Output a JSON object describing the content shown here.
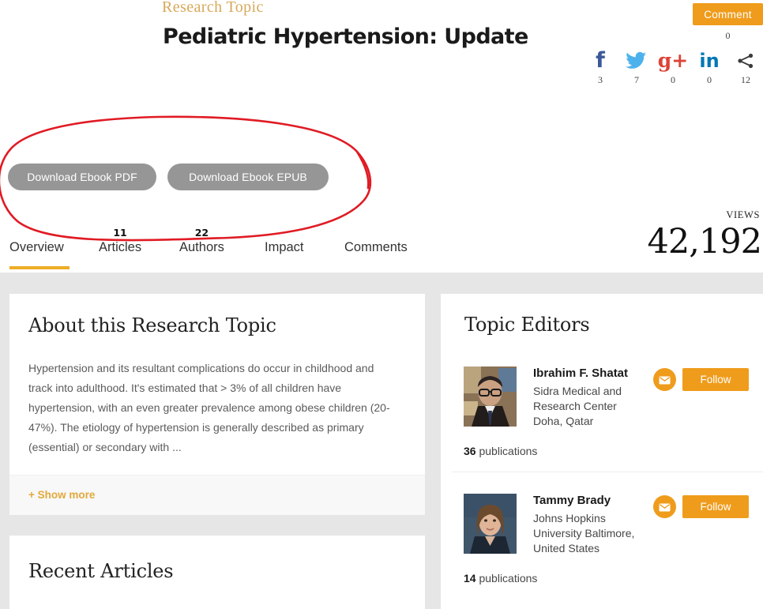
{
  "header": {
    "kicker": "Research Topic",
    "title": "Pediatric Hypertension: Update",
    "comment_label": "Comment",
    "comment_count": "0"
  },
  "social": [
    {
      "name": "facebook",
      "glyph": "f",
      "count": "3"
    },
    {
      "name": "twitter",
      "glyph": "",
      "count": "7"
    },
    {
      "name": "googleplus",
      "glyph": "g+",
      "count": "0"
    },
    {
      "name": "linkedin",
      "glyph": "in",
      "count": "0"
    },
    {
      "name": "share",
      "glyph": "",
      "count": "12"
    }
  ],
  "downloads": {
    "pdf_label": "Download Ebook PDF",
    "epub_label": "Download Ebook EPUB"
  },
  "tabs": [
    {
      "label": "Overview",
      "badge": "",
      "active": true
    },
    {
      "label": "Articles",
      "badge": "11",
      "active": false
    },
    {
      "label": "Authors",
      "badge": "22",
      "active": false
    },
    {
      "label": "Impact",
      "badge": "",
      "active": false
    },
    {
      "label": "Comments",
      "badge": "",
      "active": false
    }
  ],
  "views": {
    "label": "VIEWS",
    "value": "42,192"
  },
  "about": {
    "heading": "About this Research Topic",
    "body": "Hypertension and its resultant complications do occur in childhood and track into adulthood. It's estimated that > 3% of all children have hypertension, with an even greater prevalence among obese children (20-47%). The etiology of hypertension is generally described as primary (essential) or secondary with ...",
    "show_more": "+ Show more"
  },
  "recent_articles": {
    "heading": "Recent Articles"
  },
  "topic_editors": {
    "heading": "Topic Editors",
    "follow_label": "Follow",
    "publications_word": "publications",
    "editors": [
      {
        "name": "Ibrahim F. Shatat",
        "affiliation": "Sidra Medical and Research Center",
        "location": "Doha, Qatar",
        "publications": "36"
      },
      {
        "name": "Tammy Brady",
        "affiliation": "Johns Hopkins University",
        "location": "Baltimore, United States",
        "publications": "14"
      }
    ]
  },
  "colors": {
    "accent_orange": "#ef9c1c",
    "kicker_gold": "#d7a95a",
    "tab_underline": "#edad24",
    "download_gray": "#969696",
    "annotation_red": "#e01b24",
    "facebook": "#3b5998",
    "twitter": "#4db2ec",
    "googleplus": "#db4437",
    "linkedin": "#0077b5"
  },
  "annotation": {
    "shape": "hand-drawn-red-ellipse",
    "target": "download-ebook-buttons"
  }
}
